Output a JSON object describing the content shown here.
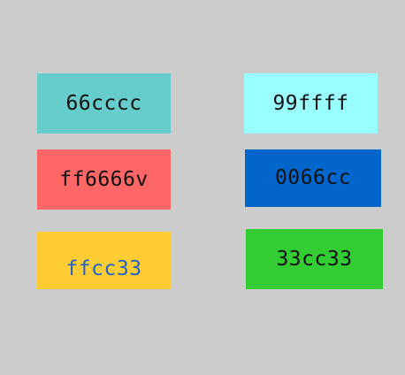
{
  "page": {
    "background": "#cccccc"
  },
  "swatches": [
    {
      "label": "66cccc",
      "background": "#66cccc",
      "text_color": "#111111"
    },
    {
      "label": "99ffff",
      "background": "#99ffff",
      "text_color": "#111111"
    },
    {
      "label": "ff6666v",
      "background": "#ff6666",
      "text_color": "#111111"
    },
    {
      "label": "0066cc",
      "background": "#0066cc",
      "text_color": "#111111"
    },
    {
      "label": "ffcc33",
      "background": "#ffcc33",
      "text_color": "#1f63c4"
    },
    {
      "label": "33cc33",
      "background": "#33cc33",
      "text_color": "#111111"
    }
  ]
}
